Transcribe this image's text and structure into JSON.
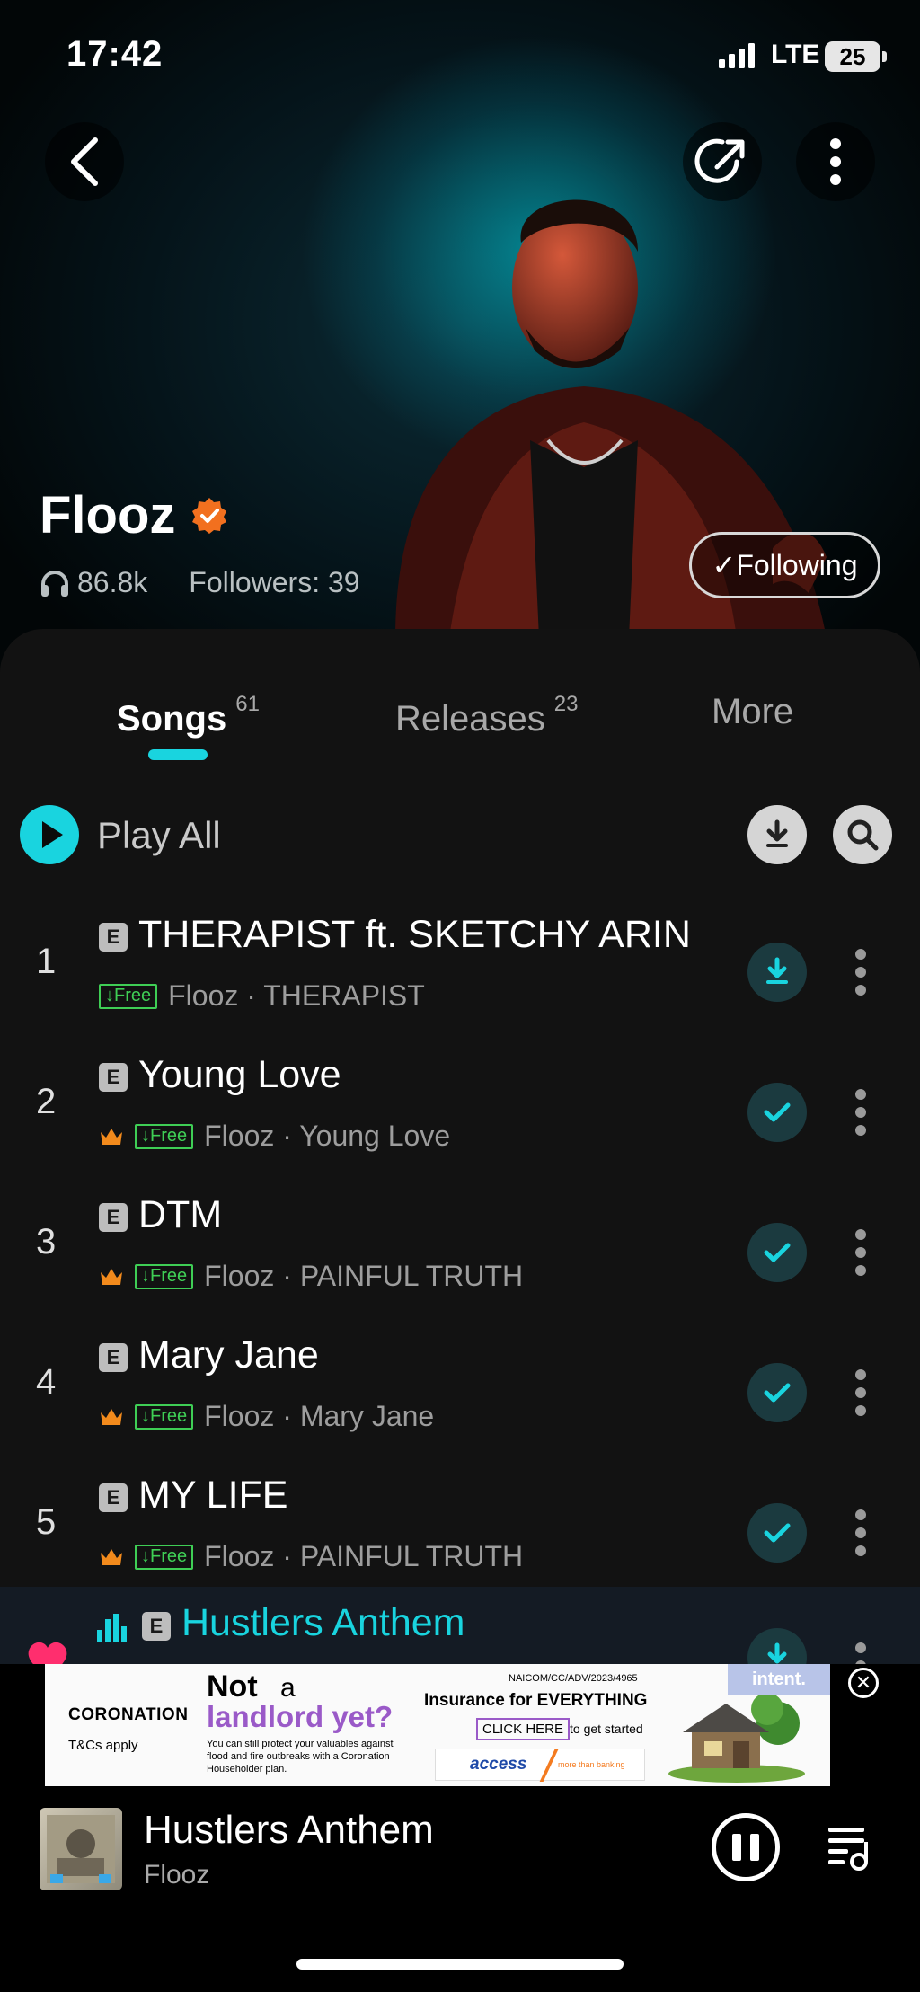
{
  "status_bar": {
    "time": "17:42",
    "network": "LTE",
    "battery": "25"
  },
  "artist": {
    "name": "Flooz",
    "plays": "86.8k",
    "followers": "Followers: 39",
    "follow_label": "✓Following"
  },
  "tabs": [
    {
      "label": "Songs",
      "count": "61"
    },
    {
      "label": "Releases",
      "count": "23"
    },
    {
      "label": "More",
      "count": ""
    }
  ],
  "play_all": {
    "label": "Play All"
  },
  "songs": [
    {
      "num": "1",
      "title": "THERAPIST ft. SKETCHY ARIN",
      "free": "Free",
      "subtitle": "Flooz · THERAPIST",
      "crown": false,
      "state": "download"
    },
    {
      "num": "2",
      "title": "Young Love",
      "free": "Free",
      "subtitle": "Flooz · Young Love",
      "crown": true,
      "state": "downloaded"
    },
    {
      "num": "3",
      "title": "DTM",
      "free": "Free",
      "subtitle": "Flooz · PAINFUL TRUTH",
      "crown": true,
      "state": "downloaded"
    },
    {
      "num": "4",
      "title": "Mary Jane",
      "free": "Free",
      "subtitle": "Flooz · Mary Jane",
      "crown": true,
      "state": "downloaded"
    },
    {
      "num": "5",
      "title": "MY LIFE",
      "free": "Free",
      "subtitle": "Flooz · PAINFUL TRUTH",
      "crown": true,
      "state": "downloaded"
    },
    {
      "num": "",
      "title": "Hustlers Anthem",
      "playing": true
    }
  ],
  "e_badge": "E",
  "ad": {
    "brand": "CORONATION",
    "tcs": "T&Cs apply",
    "headline_a": "Not",
    "headline_b": "a",
    "headline_c": "landlord yet?",
    "body": "You can still protect your valuables against flood and fire outbreaks with a Coronation Householder plan.",
    "reg": "NAICOM/CC/ADV/2023/4965",
    "tagline": "Insurance for EVERYTHING",
    "cta": "CLICK HERE",
    "cta_suffix": "to get started",
    "partner": "access",
    "partner_tag": "more than banking",
    "network": "intent."
  },
  "now_playing": {
    "title": "Hustlers Anthem",
    "artist": "Flooz"
  },
  "colors": {
    "accent": "#19d4df",
    "free_green": "#3fce55",
    "crown_orange": "#f28a1c",
    "verified_orange": "#f2701f"
  }
}
